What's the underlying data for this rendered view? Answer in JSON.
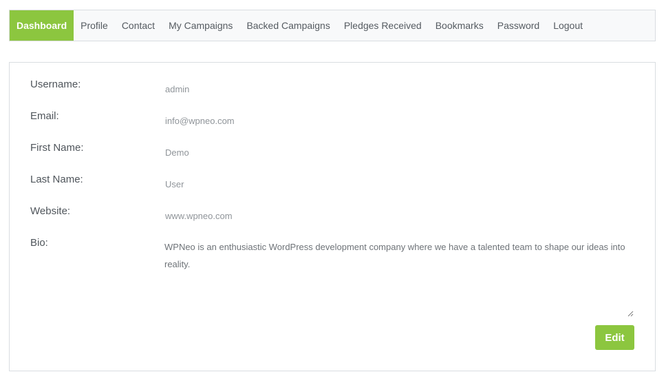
{
  "nav": {
    "items": [
      {
        "label": "Dashboard",
        "active": true
      },
      {
        "label": "Profile"
      },
      {
        "label": "Contact"
      },
      {
        "label": "My Campaigns"
      },
      {
        "label": "Backed Campaigns"
      },
      {
        "label": "Pledges Received"
      },
      {
        "label": "Bookmarks"
      },
      {
        "label": "Password"
      },
      {
        "label": "Logout"
      }
    ]
  },
  "profile": {
    "username_label": "Username:",
    "username_value": "admin",
    "email_label": "Email:",
    "email_value": "info@wpneo.com",
    "first_name_label": "First Name:",
    "first_name_value": "Demo",
    "last_name_label": "Last Name:",
    "last_name_value": "User",
    "website_label": "Website:",
    "website_value": "www.wpneo.com",
    "bio_label": "Bio:",
    "bio_value": "WPNeo is an enthusiastic WordPress development company where we have a talented team to shape our ideas into reality."
  },
  "actions": {
    "edit_label": "Edit"
  },
  "colors": {
    "accent": "#8cc63f",
    "border": "#d9dde1",
    "nav_background": "#f8f9fa"
  },
  "icons": {
    "resize_grip": "resize-grip-icon"
  }
}
